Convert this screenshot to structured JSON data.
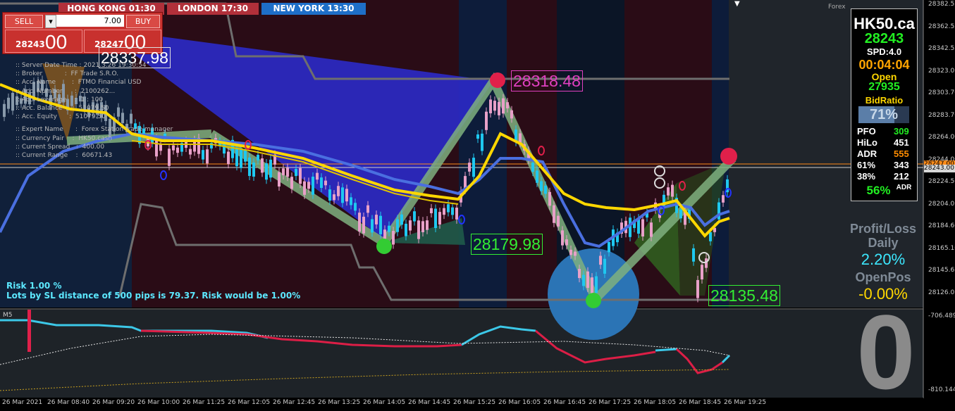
{
  "sessions": [
    {
      "label": "HONG KONG 01:30",
      "color": "#b1303a"
    },
    {
      "label": "LONDON  17:30",
      "color": "#b1303a"
    },
    {
      "label": "NEW YORK  13:30",
      "color": "#1e6fc8"
    }
  ],
  "trade_panel": {
    "sell_label": "SELL",
    "buy_label": "BUY",
    "lot_value": "7.00",
    "sell_price_small": "28243",
    "sell_price_big": "00",
    "buy_price_small": "28247",
    "buy_price_big": "00"
  },
  "price_labels": {
    "top_left": "28337.98",
    "peak": "28318.48",
    "low1": "28179.98",
    "low2": "28135.48"
  },
  "account_info": [
    ":: Server Date Time : 2021.3.26 19:30:54",
    ":: Broker           :  FF Trade S.R.O.",
    ":: Acc. Name        :  FTMO Financial USD",
    ":: Acc. Number      :  2100262...",
    ":: Acc. Leverage    :  1 : 100",
    ":: Acc. Balance     :  51079.50",
    ":: Acc. Equity      :  51079.50",
    ":: Expert Name      :  Forex Station trade manager",
    ":: Currency Pair    :  HK50.cash",
    ":: Current Spread   :  400.00",
    ":: Current Range    :  60671.43"
  ],
  "risk": {
    "line1": "Risk 1.00 %",
    "line2": "Lots by SL distance of 500 pips is 79.37. Risk would be 1.00%"
  },
  "forex_label": "Forex",
  "side_panel": {
    "symbol": "HK50.ca",
    "price": "28243",
    "spread": "SPD:4.0",
    "timer": "00:04:04",
    "open_label": "Open",
    "open_value": "27935",
    "bidratio_label": "BidRatio",
    "bidratio_value": "71%",
    "bidratio_fill": 0.71,
    "rows": [
      {
        "label": "PFO",
        "value": "309",
        "color": "#22ee22"
      },
      {
        "label": "HiLo",
        "value": "451",
        "color": "#ffffff"
      },
      {
        "label": "ADR",
        "value": "555",
        "color": "#ff8c00"
      },
      {
        "label": "61%",
        "value": "343",
        "color": "#ffffff"
      },
      {
        "label": "38%",
        "value": "212",
        "color": "#ffffff"
      }
    ],
    "adr_pct": "56%",
    "adr_suffix": "ADR"
  },
  "profit": {
    "title1": "Profit/Loss",
    "title2": "Daily",
    "daily_value": "2.20%",
    "openpos_label": "OpenPos",
    "openpos_value": "-0.00%"
  },
  "price_axis": [
    "28382.55",
    "28362.55",
    "28342.55",
    "28323.05",
    "28303.70",
    "28283.70",
    "28264.00",
    "28244.00",
    "28224.50",
    "28204.05",
    "28184.60",
    "28165.10",
    "28145.65",
    "28126.05"
  ],
  "price_tags": {
    "ask": "28247.00",
    "bid": "28243.00"
  },
  "indicator": {
    "label": "M5",
    "axis_top": "-706.4891",
    "axis_bottom": "-810.144",
    "big_value": "0"
  },
  "time_axis": [
    "26 Mar 2021",
    "26 Mar 08:40",
    "26 Mar 09:20",
    "26 Mar 10:00",
    "26 Mar 11:25",
    "26 Mar 12:05",
    "26 Mar 12:45",
    "26 Mar 13:25",
    "26 Mar 14:05",
    "26 Mar 14:45",
    "26 Mar 15:25",
    "26 Mar 16:05",
    "26 Mar 16:45",
    "26 Mar 17:25",
    "26 Mar 18:05",
    "26 Mar 18:45",
    "26 Mar 19:25"
  ],
  "colors": {
    "up_candle": "#1ec8f0",
    "down_candle": "#e8a0c8",
    "yellow_ma": "#ffd700",
    "blue_ma": "#4a6fe0",
    "zigzag": "#7fb07f"
  }
}
